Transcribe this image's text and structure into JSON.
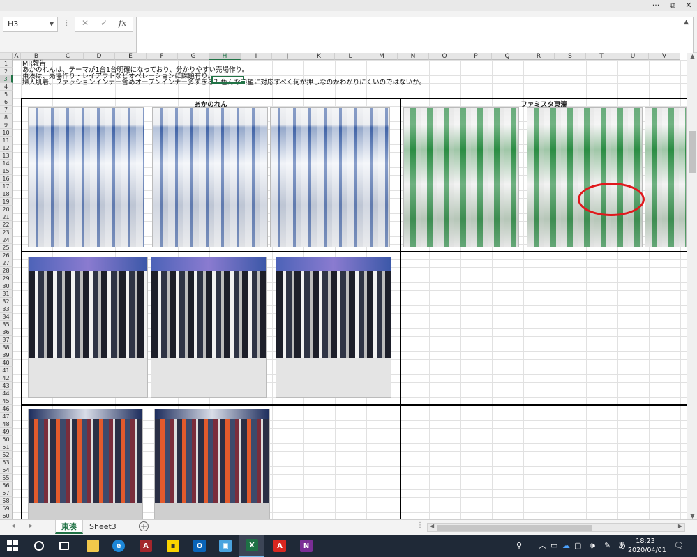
{
  "window": {
    "controls": [
      "···",
      "⧉",
      "✕"
    ]
  },
  "formula_bar": {
    "name_box": "H3",
    "cancel_icon": "✕",
    "enter_icon": "✓",
    "fx_label": "fx",
    "value": ""
  },
  "columns": [
    "A",
    "B",
    "C",
    "D",
    "E",
    "F",
    "G",
    "H",
    "I",
    "J",
    "K",
    "L",
    "M",
    "N",
    "O",
    "P",
    "Q",
    "R",
    "S",
    "T",
    "U",
    "V"
  ],
  "selected_column": "H",
  "rows": [
    "1",
    "2",
    "3",
    "4",
    "5",
    "6",
    "7",
    "8",
    "9",
    "10",
    "11",
    "12",
    "13",
    "14",
    "15",
    "16",
    "17",
    "18",
    "19",
    "20",
    "21",
    "22",
    "23",
    "24",
    "25",
    "26",
    "27",
    "28",
    "29",
    "30",
    "31",
    "32",
    "33",
    "34",
    "35",
    "36",
    "37",
    "38",
    "39",
    "40",
    "41",
    "42",
    "43",
    "44",
    "45",
    "46",
    "47",
    "48",
    "49",
    "50",
    "51",
    "52",
    "53",
    "54",
    "55",
    "56",
    "57",
    "58",
    "59",
    "60"
  ],
  "selected_row": "3",
  "cells": {
    "b1": "MR報告",
    "b2": "あかのれんは、テーマが1台1台明確になっており、分かりやすい売場作り。",
    "b3": "東湊は、売場作り・レイアウトなどオペレーションに課題有り。",
    "b4": "婦人肌着、ファッションインナー含めオープンインナー多すぎる？色んな要望に対応すべく何が押しなのかわかりにくいのではないか。"
  },
  "sections": {
    "left_title": "あかのれん",
    "right_title": "ファミスタ東湊"
  },
  "sheets": {
    "tabs": [
      "東湊",
      "Sheet3"
    ],
    "active": "東湊",
    "add_label": "+"
  },
  "taskbar": {
    "apps": [
      "start",
      "search",
      "task-view",
      "file-explorer",
      "edge",
      "access",
      "sticky-notes",
      "outlook",
      "photos",
      "excel",
      "acrobat",
      "onenote"
    ],
    "ime": "あ",
    "time": "18:23",
    "date": "2020/04/01"
  }
}
